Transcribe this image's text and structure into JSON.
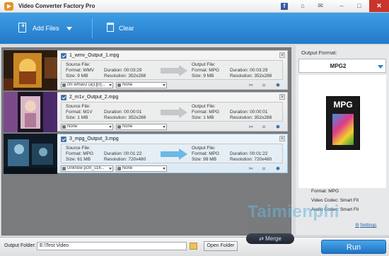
{
  "app": {
    "title": "Video Converter Factory Pro"
  },
  "titlebar": {
    "facebook_glyph": "f",
    "home_glyph": "⌂",
    "message_glyph": "✉",
    "minimize_glyph": "–",
    "maximize_glyph": "□",
    "close_glyph": "✕"
  },
  "toolbar": {
    "add_files_label": "Add Files",
    "clear_label": "Clear"
  },
  "files": [
    {
      "name": "1_wmv_Output_1.mpg",
      "source": {
        "header": "Source File:",
        "format": "Format: WMV",
        "duration": "Duration: 00:03:29",
        "size": "Size: 9 MB",
        "resolution": "Resolution: 352x288"
      },
      "output": {
        "header": "Output File:",
        "format": "Format: MPG",
        "duration": "Duration: 00:03:29",
        "size": "Size: 9 MB",
        "resolution": "Resolution: 352x288"
      },
      "audio_track": "chi wmav2 (a[1][0]...",
      "subtitle": "None"
    },
    {
      "name": "2_m1v_Output_2.mpg",
      "source": {
        "header": "Source File:",
        "format": "Format: M1V",
        "duration": "Duration: 00:00:01",
        "size": "Size: 1 MB",
        "resolution": "Resolution: 352x288"
      },
      "output": {
        "header": "Output File:",
        "format": "Format: MPG",
        "duration": "Duration: 00:00:01",
        "size": "Size: 1 MB",
        "resolution": "Resolution: 352x288"
      },
      "audio_track": "None",
      "subtitle": "None"
    },
    {
      "name": "3_mpg_Output_3.mpg",
      "source": {
        "header": "Source File:",
        "format": "Format: MPG",
        "duration": "Duration: 00:01:22",
        "size": "Size: 61 MB",
        "resolution": "Resolution: 720x480"
      },
      "output": {
        "header": "Output File:",
        "format": "Format: MPG",
        "duration": "Duration: 00:01:22",
        "size": "Size: 99 MB",
        "resolution": "Resolution: 720x480"
      },
      "audio_track": "Unknow pcm_s16...",
      "subtitle": "None"
    }
  ],
  "row_actions": {
    "cut_glyph": "✂",
    "crop_glyph": "⌗",
    "effect_glyph": "✸",
    "close_glyph": "✕"
  },
  "side": {
    "output_format_label": "Output Format:",
    "format_name": "MPG2",
    "icon_text": "MPG",
    "format_spec": "Format: MPG",
    "video_codec": "Video Codec: Smart Fit",
    "audio_codec": "Audio Codec: Smart Fit",
    "settings_label": "Settings",
    "settings_glyph": "⚙"
  },
  "watermark": "Taimienphi",
  "bottom": {
    "merge_label": "Merge",
    "merge_glyph": "⇄",
    "output_folder_label": "Output Folder:",
    "output_folder_value": "E:\\Test Video",
    "open_folder_label": "Open Folder",
    "run_label": "Run"
  },
  "colors": {
    "toolbar_blue": "#2a86d6",
    "run_blue": "#2f8be0",
    "close_red": "#c9342c",
    "selected_row": "#dce9f2"
  }
}
